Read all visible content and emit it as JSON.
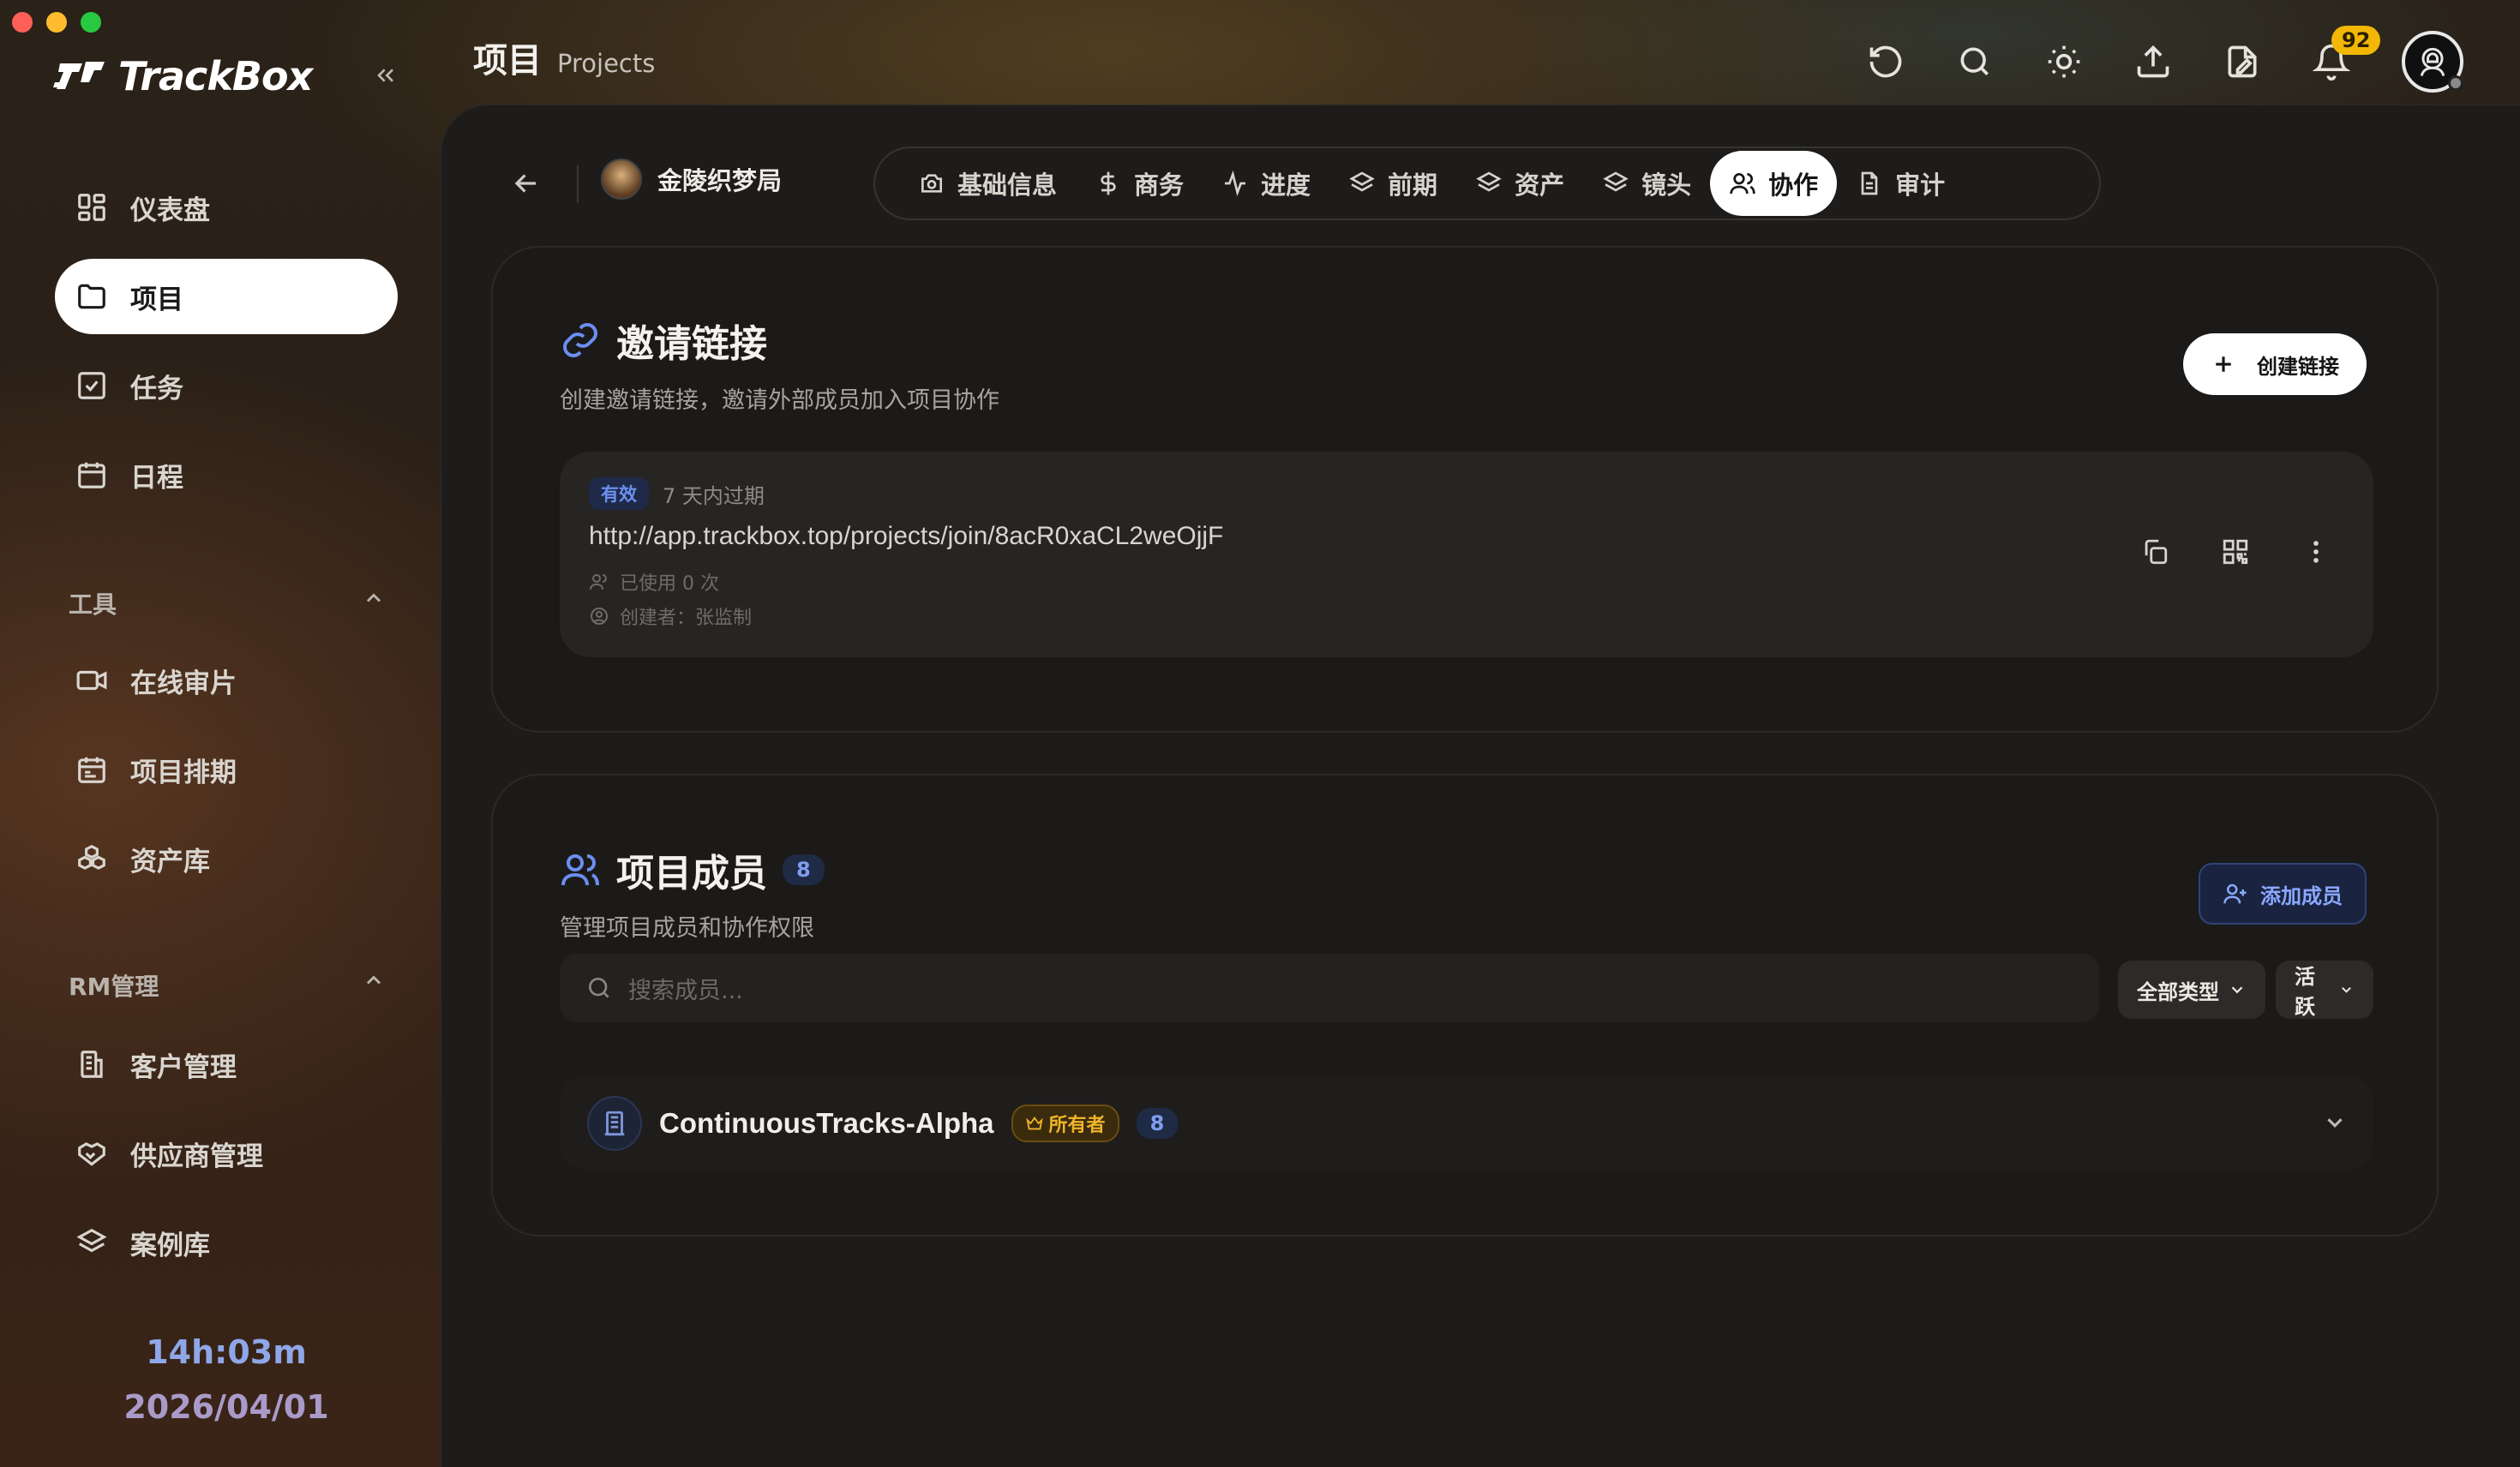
{
  "app": {
    "name": "TrackBox"
  },
  "sidebar": {
    "nav": [
      {
        "label": "仪表盘",
        "icon": "dashboard-icon"
      },
      {
        "label": "项目",
        "icon": "folder-icon",
        "active": true
      },
      {
        "label": "任务",
        "icon": "checkbox-icon"
      },
      {
        "label": "日程",
        "icon": "calendar-icon"
      }
    ],
    "tools_section": "工具",
    "tools": [
      {
        "label": "在线审片",
        "icon": "video-icon"
      },
      {
        "label": "项目排期",
        "icon": "schedule-icon"
      },
      {
        "label": "资产库",
        "icon": "boxes-icon"
      }
    ],
    "rm_section": "RM管理",
    "rm": [
      {
        "label": "客户管理",
        "icon": "building-icon"
      },
      {
        "label": "供应商管理",
        "icon": "handshake-icon"
      },
      {
        "label": "案例库",
        "icon": "layers-icon"
      }
    ],
    "clock_time": "14h:03m",
    "clock_date": "2026/04/01"
  },
  "header": {
    "title_cn": "项目",
    "title_en": "Projects",
    "notification_count": "92"
  },
  "project": {
    "name": "金陵织梦局",
    "tabs": [
      {
        "label": "基础信息",
        "icon": "camera-icon"
      },
      {
        "label": "商务",
        "icon": "dollar-icon"
      },
      {
        "label": "进度",
        "icon": "activity-icon"
      },
      {
        "label": "前期",
        "icon": "layers-icon"
      },
      {
        "label": "资产",
        "icon": "layers-icon"
      },
      {
        "label": "镜头",
        "icon": "layers-icon"
      },
      {
        "label": "协作",
        "icon": "users-icon",
        "active": true
      },
      {
        "label": "审计",
        "icon": "file-icon"
      }
    ]
  },
  "invite": {
    "title": "邀请链接",
    "subtitle": "创建邀请链接，邀请外部成员加入项目协作",
    "create_button": "创建链接",
    "link": {
      "status": "有效",
      "expiry": "7 天内过期",
      "url": "http://app.trackbox.top/projects/join/8acR0xaCL2weOjjF",
      "used": "已使用 0 次",
      "creator": "创建者：张监制"
    }
  },
  "members": {
    "title": "项目成员",
    "count": "8",
    "subtitle": "管理项目成员和协作权限",
    "add_button": "添加成员",
    "search_placeholder": "搜索成员...",
    "filter_type": "全部类型",
    "filter_status": "活跃",
    "group": {
      "name": "ContinuousTracks-Alpha",
      "role": "所有者",
      "count": "8"
    }
  },
  "colors": {
    "accent": "#6c8ef0",
    "owner": "#f0b429",
    "badge": "#f2b705"
  }
}
